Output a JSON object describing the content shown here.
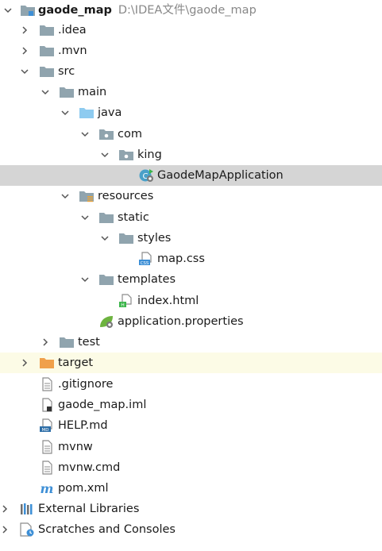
{
  "project": {
    "name": "gaode_map",
    "path": "D:\\IDEA文件\\gaode_map"
  },
  "items": [
    {
      "label": "gaode_map",
      "icon": "module-folder-icon"
    },
    {
      "label": ".idea",
      "icon": "folder-icon"
    },
    {
      "label": ".mvn",
      "icon": "folder-icon"
    },
    {
      "label": "src",
      "icon": "folder-icon"
    },
    {
      "label": "main",
      "icon": "folder-icon"
    },
    {
      "label": "java",
      "icon": "source-root-folder-icon"
    },
    {
      "label": "com",
      "icon": "package-icon"
    },
    {
      "label": "king",
      "icon": "package-icon"
    },
    {
      "label": "GaodeMapApplication",
      "icon": "spring-boot-class-icon"
    },
    {
      "label": "resources",
      "icon": "resources-root-folder-icon"
    },
    {
      "label": "static",
      "icon": "folder-icon"
    },
    {
      "label": "styles",
      "icon": "folder-icon"
    },
    {
      "label": "map.css",
      "icon": "css-file-icon"
    },
    {
      "label": "templates",
      "icon": "folder-icon"
    },
    {
      "label": "index.html",
      "icon": "html-file-icon"
    },
    {
      "label": "application.properties",
      "icon": "spring-properties-icon"
    },
    {
      "label": "test",
      "icon": "folder-icon"
    },
    {
      "label": "target",
      "icon": "excluded-folder-icon"
    },
    {
      "label": ".gitignore",
      "icon": "text-file-icon"
    },
    {
      "label": "gaode_map.iml",
      "icon": "iml-file-icon"
    },
    {
      "label": "HELP.md",
      "icon": "markdown-file-icon"
    },
    {
      "label": "mvnw",
      "icon": "text-file-icon"
    },
    {
      "label": "mvnw.cmd",
      "icon": "text-file-icon"
    },
    {
      "label": "pom.xml",
      "icon": "maven-icon"
    },
    {
      "label": "External Libraries",
      "icon": "libraries-icon"
    },
    {
      "label": "Scratches and Consoles",
      "icon": "scratches-icon"
    }
  ],
  "colors": {
    "selection": "#d5d5d5",
    "excluded_row": "#fcfbe6",
    "folder": "#90a4ae",
    "source_root": "#8ecbf0",
    "excluded": "#f0a04b",
    "path_text": "#888888"
  }
}
